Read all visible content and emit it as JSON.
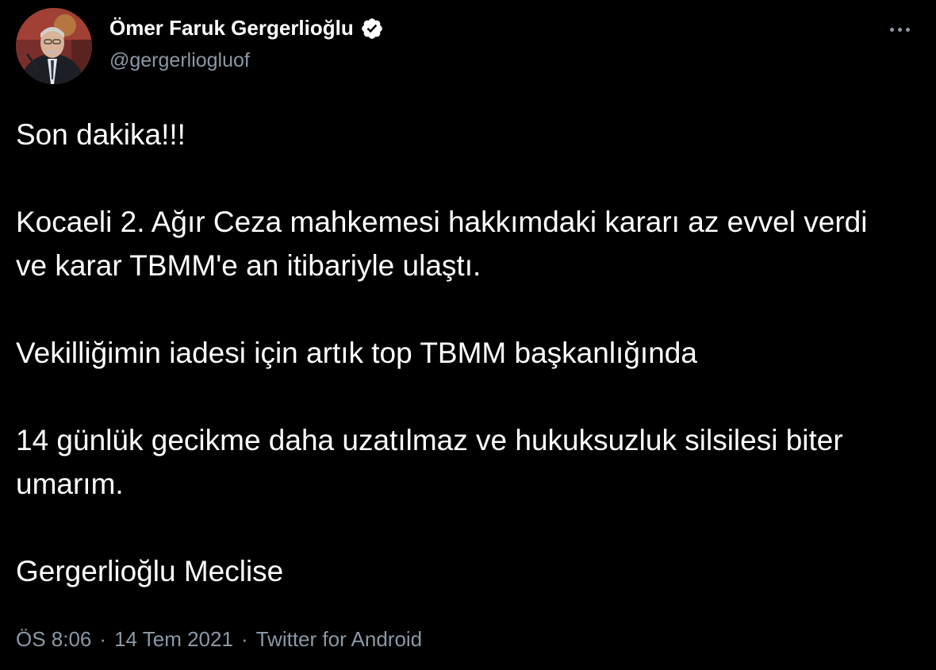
{
  "author": {
    "name": "Ömer Faruk Gergerlioğlu",
    "handle": "@gergerliogluof",
    "verified": true,
    "verified_color": "#ffffff"
  },
  "tweet": {
    "paragraphs": [
      "Son dakika!!!",
      "Kocaeli 2. Ağır Ceza mahkemesi hakkımdaki kararı az evvel verdi ve karar TBMM'e an itibariyle ulaştı.",
      "Vekilliğimin iadesi için artık top TBMM başkanlığında",
      "14 günlük gecikme daha uzatılmaz ve hukuksuzluk silsilesi biter umarım.",
      "Gergerlioğlu Meclise"
    ]
  },
  "meta": {
    "time": "ÖS 8:06",
    "separator": "·",
    "date": "14 Tem 2021",
    "source": "Twitter for Android"
  },
  "icons": {
    "more": "more-options-icon",
    "verified": "verified-badge-icon"
  },
  "colors": {
    "background": "#000000",
    "text": "#ffffff",
    "secondary": "#8b98a5"
  }
}
